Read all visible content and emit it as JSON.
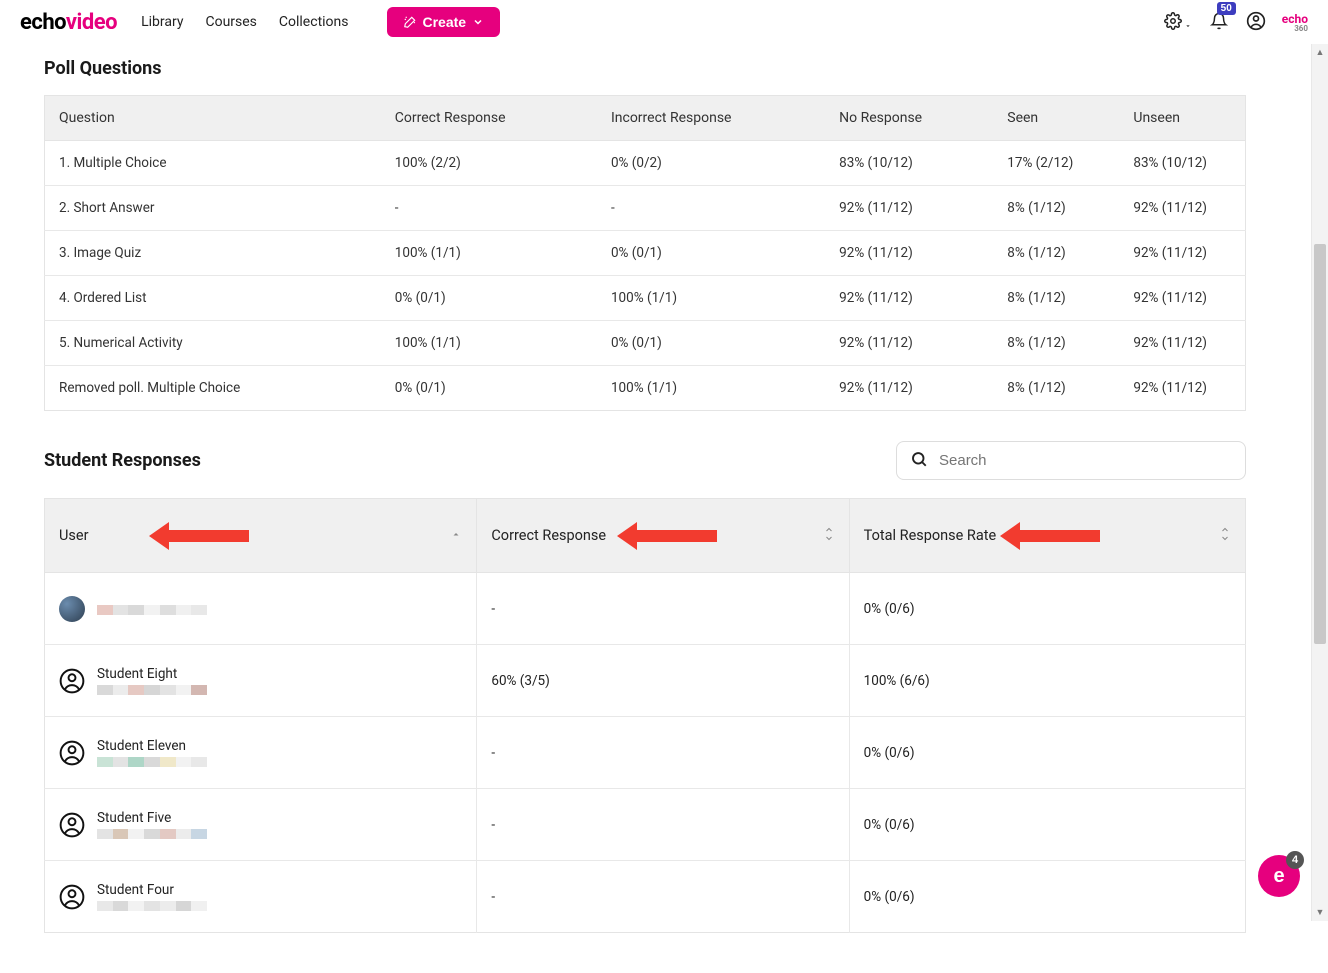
{
  "nav": {
    "logo_a": "echo",
    "logo_b": "video",
    "library": "Library",
    "courses": "Courses",
    "collections": "Collections",
    "create": "Create",
    "notif_count": "50"
  },
  "poll": {
    "title": "Poll Questions",
    "headers": {
      "question": "Question",
      "correct": "Correct Response",
      "incorrect": "Incorrect Response",
      "noresp": "No Response",
      "seen": "Seen",
      "unseen": "Unseen"
    },
    "rows": [
      {
        "q": "1. Multiple Choice",
        "c": "100% (2/2)",
        "i": "0% (0/2)",
        "n": "83% (10/12)",
        "s": "17% (2/12)",
        "u": "83% (10/12)"
      },
      {
        "q": "2. Short Answer",
        "c": "-",
        "i": "-",
        "n": "92% (11/12)",
        "s": "8% (1/12)",
        "u": "92% (11/12)"
      },
      {
        "q": "3. Image Quiz",
        "c": "100% (1/1)",
        "i": "0% (0/1)",
        "n": "92% (11/12)",
        "s": "8% (1/12)",
        "u": "92% (11/12)"
      },
      {
        "q": "4. Ordered List",
        "c": "0% (0/1)",
        "i": "100% (1/1)",
        "n": "92% (11/12)",
        "s": "8% (1/12)",
        "u": "92% (11/12)"
      },
      {
        "q": "5. Numerical Activity",
        "c": "100% (1/1)",
        "i": "0% (0/1)",
        "n": "92% (11/12)",
        "s": "8% (1/12)",
        "u": "92% (11/12)"
      },
      {
        "q": "Removed poll. Multiple Choice",
        "c": "0% (0/1)",
        "i": "100% (1/1)",
        "n": "92% (11/12)",
        "s": "8% (1/12)",
        "u": "92% (11/12)"
      }
    ]
  },
  "sr": {
    "title": "Student Responses",
    "search_placeholder": "Search",
    "headers": {
      "user": "User",
      "correct": "Correct Response",
      "total": "Total Response Rate"
    },
    "rows": [
      {
        "name": "",
        "correct": "-",
        "total": "0% (0/6)",
        "avatar": "img"
      },
      {
        "name": "Student Eight",
        "correct": "60% (3/5)",
        "total": "100% (6/6)",
        "avatar": "icon"
      },
      {
        "name": "Student Eleven",
        "correct": "-",
        "total": "0% (0/6)",
        "avatar": "icon"
      },
      {
        "name": "Student Five",
        "correct": "-",
        "total": "0% (0/6)",
        "avatar": "icon"
      },
      {
        "name": "Student Four",
        "correct": "-",
        "total": "0% (0/6)",
        "avatar": "icon"
      }
    ]
  },
  "fab_count": "4",
  "blur_colors": [
    [
      "#e9c9c3",
      "#e3e3e3",
      "#d9d9d9",
      "#f2f2f2",
      "#dedede",
      "#f0f0f0",
      "#e8e8e8"
    ],
    [
      "#d9d9d9",
      "#ececec",
      "#e6c9c3",
      "#d6d6d6",
      "#e3e3e3",
      "#f2f2f2",
      "#d3b7b1"
    ],
    [
      "#c9e3d6",
      "#e3e3e3",
      "#aed6c7",
      "#d9d9d9",
      "#f0e8c9",
      "#f2f2f2",
      "#e8e8e8"
    ],
    [
      "#e3e3e3",
      "#d9c7b7",
      "#f2f2f2",
      "#d9d9d9",
      "#e3c9c3",
      "#ececec",
      "#c7d6e3"
    ],
    [
      "#e8e8e8",
      "#d9d9d9",
      "#f2f2f2",
      "#e3e3e3",
      "#ececec",
      "#d6d6d6",
      "#f0f0f0"
    ]
  ]
}
